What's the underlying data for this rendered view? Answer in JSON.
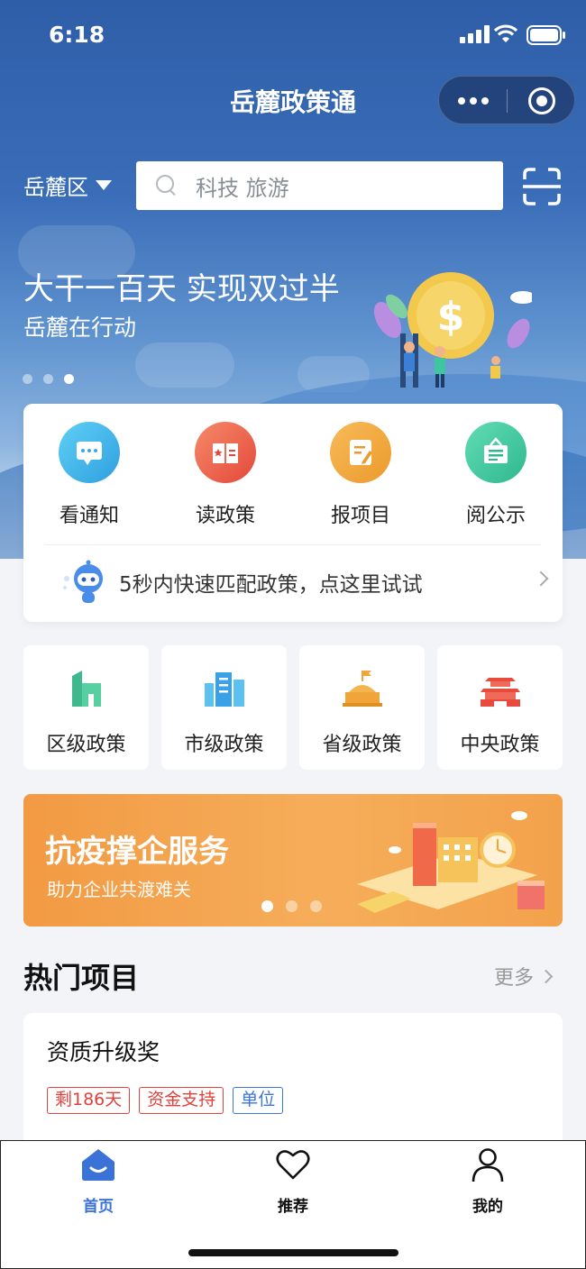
{
  "status": {
    "time": "6:18"
  },
  "nav": {
    "title": "岳麓政策通"
  },
  "search": {
    "region": "岳麓区",
    "placeholder": "科技 旅游"
  },
  "banner": {
    "title": "大干一百天 实现双过半",
    "subtitle": "岳麓在行动"
  },
  "quick": {
    "items": [
      {
        "label": "看通知",
        "color": "#3fb2e8"
      },
      {
        "label": "读政策",
        "color": "#ec6448"
      },
      {
        "label": "报项目",
        "color": "#f0a43a"
      },
      {
        "label": "阅公示",
        "color": "#3fc6a0"
      }
    ],
    "match_text": "5秒内快速匹配政策，点这里试试"
  },
  "levels": [
    {
      "label": "区级政策"
    },
    {
      "label": "市级政策"
    },
    {
      "label": "省级政策"
    },
    {
      "label": "中央政策"
    }
  ],
  "promo": {
    "title": "抗疫撑企服务",
    "subtitle": "助力企业共渡难关"
  },
  "hot": {
    "title": "热门项目",
    "more": "更多",
    "project": {
      "title": "资质升级奖",
      "tags": [
        "剩186天",
        "资金支持",
        "单位"
      ]
    }
  },
  "tabs": [
    {
      "label": "首页",
      "icon": "home-icon"
    },
    {
      "label": "推荐",
      "icon": "heart-icon"
    },
    {
      "label": "我的",
      "icon": "user-icon"
    }
  ],
  "colors": {
    "accent": "#3a72d8",
    "tag_red": "#e2413b",
    "tag_blue": "#3b77d8"
  }
}
